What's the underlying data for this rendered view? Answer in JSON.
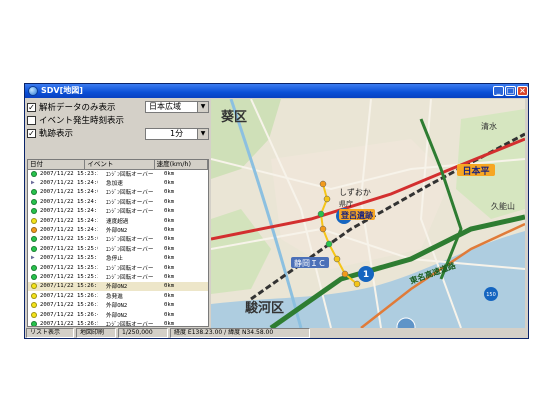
{
  "window": {
    "title": "SDV[地図]",
    "buttons": {
      "minimize": "_",
      "maximize": "□",
      "close": "×"
    }
  },
  "controls": {
    "analysis_only": {
      "label": "解析データのみ表示",
      "checked": true
    },
    "event_time": {
      "label": "イベント発生時刻表示",
      "checked": false
    },
    "track": {
      "label": "軌跡表示",
      "checked": true
    },
    "map_area_select": "日本広域",
    "interval_select": "1分"
  },
  "list": {
    "headers": [
      "日付",
      "イベント",
      "速度(km/h)"
    ],
    "rows": [
      {
        "marker": "green",
        "date": "2007/11/22 15:23:37",
        "event": "ｴﾝｼﾞﾝ回転オーバー",
        "speed": "0km"
      },
      {
        "marker": "flag",
        "date": "2007/11/22 15:24:02",
        "event": "急加速",
        "speed": "0km"
      },
      {
        "marker": "green",
        "date": "2007/11/22 15:24:06",
        "event": "ｴﾝｼﾞﾝ回転オーバー",
        "speed": "0km"
      },
      {
        "marker": "green",
        "date": "2007/11/22 15:24:10",
        "event": "ｴﾝｼﾞﾝ回転オーバー",
        "speed": "0km"
      },
      {
        "marker": "green",
        "date": "2007/11/22 15:24:14",
        "event": "ｴﾝｼﾞﾝ回転オーバー",
        "speed": "0km"
      },
      {
        "marker": "yellow",
        "date": "2007/11/22 15:24:20",
        "event": "速度超過",
        "speed": "0km"
      },
      {
        "marker": "orange",
        "date": "2007/11/22 15:24:26",
        "event": "外部ON2",
        "speed": "0km"
      },
      {
        "marker": "green",
        "date": "2007/11/22 15:25:00",
        "event": "ｴﾝｼﾞﾝ回転オーバー",
        "speed": "0km"
      },
      {
        "marker": "green",
        "date": "2007/11/22 15:25:08",
        "event": "ｴﾝｼﾞﾝ回転オーバー",
        "speed": "0km"
      },
      {
        "marker": "flag",
        "date": "2007/11/22 15:25:13",
        "event": "急停止",
        "speed": "0km"
      },
      {
        "marker": "green",
        "date": "2007/11/22 15:25:20",
        "event": "ｴﾝｼﾞﾝ回転オーバー",
        "speed": "0km"
      },
      {
        "marker": "green",
        "date": "2007/11/22 15:25:25",
        "event": "ｴﾝｼﾞﾝ回転オーバー",
        "speed": "0km"
      },
      {
        "marker": "yellow",
        "date": "2007/11/22 15:26:14",
        "event": "外部ON2",
        "speed": "0km",
        "selected": true
      },
      {
        "marker": "yellow",
        "date": "2007/11/22 15:26:20",
        "event": "急発進",
        "speed": "0km"
      },
      {
        "marker": "yellow",
        "date": "2007/11/22 15:26:35",
        "event": "外部ON2",
        "speed": "0km"
      },
      {
        "marker": "yellow",
        "date": "2007/11/22 15:26:43",
        "event": "外部ON2",
        "speed": "0km"
      },
      {
        "marker": "green",
        "date": "2007/11/22 15:26:51",
        "event": "ｴﾝｼﾞﾝ回転オーバー",
        "speed": "0km"
      },
      {
        "marker": "flag",
        "date": "2007/11/22 15:26:58",
        "event": "急減速",
        "speed": "0km"
      }
    ]
  },
  "map": {
    "labels": {
      "ward": "葵区",
      "suruga": "駿河区",
      "shizuoka_station": "しずおか",
      "kencho": "県庁",
      "torohiru": "登呂遺跡",
      "ic": "静岡ＩＣ",
      "nihondaira": "日本平",
      "tokaido": "東名高速道路",
      "shimizu": "清水",
      "kunozan": "久能山",
      "route1": "1",
      "route150": "150",
      "route52": "52"
    }
  },
  "status": {
    "list_view": "リスト表示",
    "print_map": "地図印刷",
    "scale": "1/250,000",
    "coords": "経度 E138.23.00 / 緯度 N34.58.00"
  },
  "colors": {
    "title_bar": "#0a4fd6",
    "map_bg": "#eae5d5",
    "expressway": "#2e7d32",
    "national_road": "#d32f2f",
    "track_line": "#f5c518"
  }
}
